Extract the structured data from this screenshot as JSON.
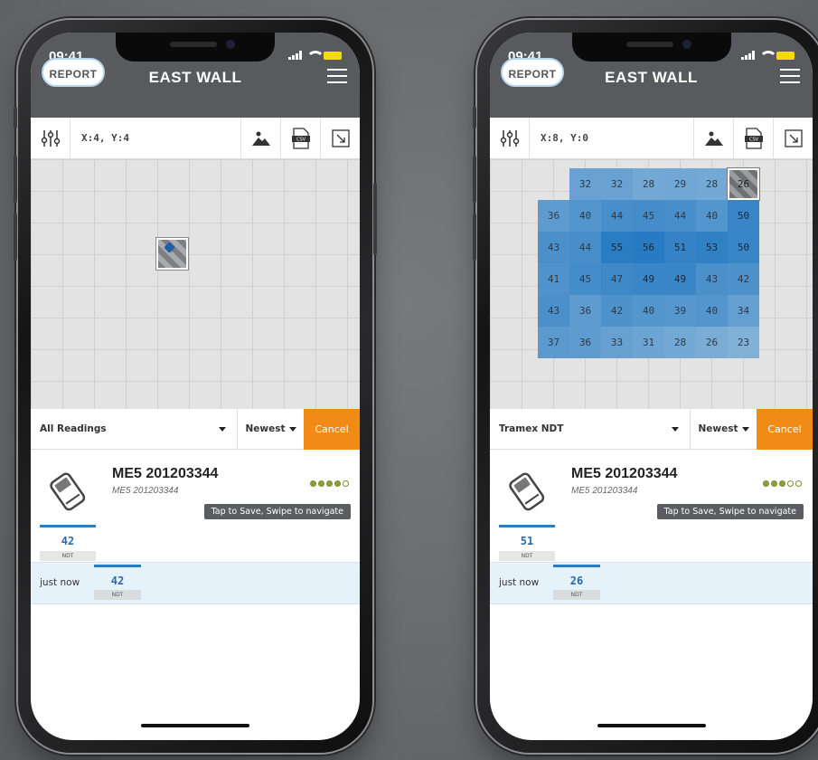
{
  "phones": [
    {
      "status_time": "09:41",
      "report_label": "REPORT",
      "title": "EAST WALL",
      "coords": "X:4, Y:4",
      "filter": "All Readings",
      "sort": "Newest",
      "cancel": "Cancel",
      "device_name": "ME5 201203344",
      "device_sub": "ME5 201203344",
      "tap_hint": "Tap to Save, Swipe to navigate",
      "reading_value": "42",
      "reading_tag": "NDT",
      "history_time": "just now",
      "history_value": "42",
      "history_tag": "NDT",
      "quality_dots": 4
    },
    {
      "status_time": "09:41",
      "report_label": "REPORT",
      "title": "EAST WALL",
      "coords": "X:8, Y:0",
      "filter": "Tramex NDT",
      "sort": "Newest",
      "cancel": "Cancel",
      "device_name": "ME5 201203344",
      "device_sub": "ME5 201203344",
      "tap_hint": "Tap to Save, Swipe to navigate",
      "reading_value": "51",
      "reading_tag": "NDT",
      "history_time": "just now",
      "history_value": "26",
      "history_tag": "NDT",
      "quality_dots": 3,
      "heatmap": [
        [
          null,
          "32",
          "32",
          "28",
          "29",
          "28",
          "26"
        ],
        [
          "36",
          "40",
          "44",
          "45",
          "44",
          "40",
          "50"
        ],
        [
          "43",
          "44",
          "55",
          "56",
          "51",
          "53",
          "50"
        ],
        [
          "41",
          "45",
          "47",
          "49",
          "49",
          "43",
          "42"
        ],
        [
          "43",
          "36",
          "42",
          "40",
          "39",
          "40",
          "34"
        ],
        [
          "37",
          "36",
          "33",
          "31",
          "28",
          "26",
          "23"
        ]
      ],
      "selected_cell": [
        0,
        6
      ]
    }
  ]
}
